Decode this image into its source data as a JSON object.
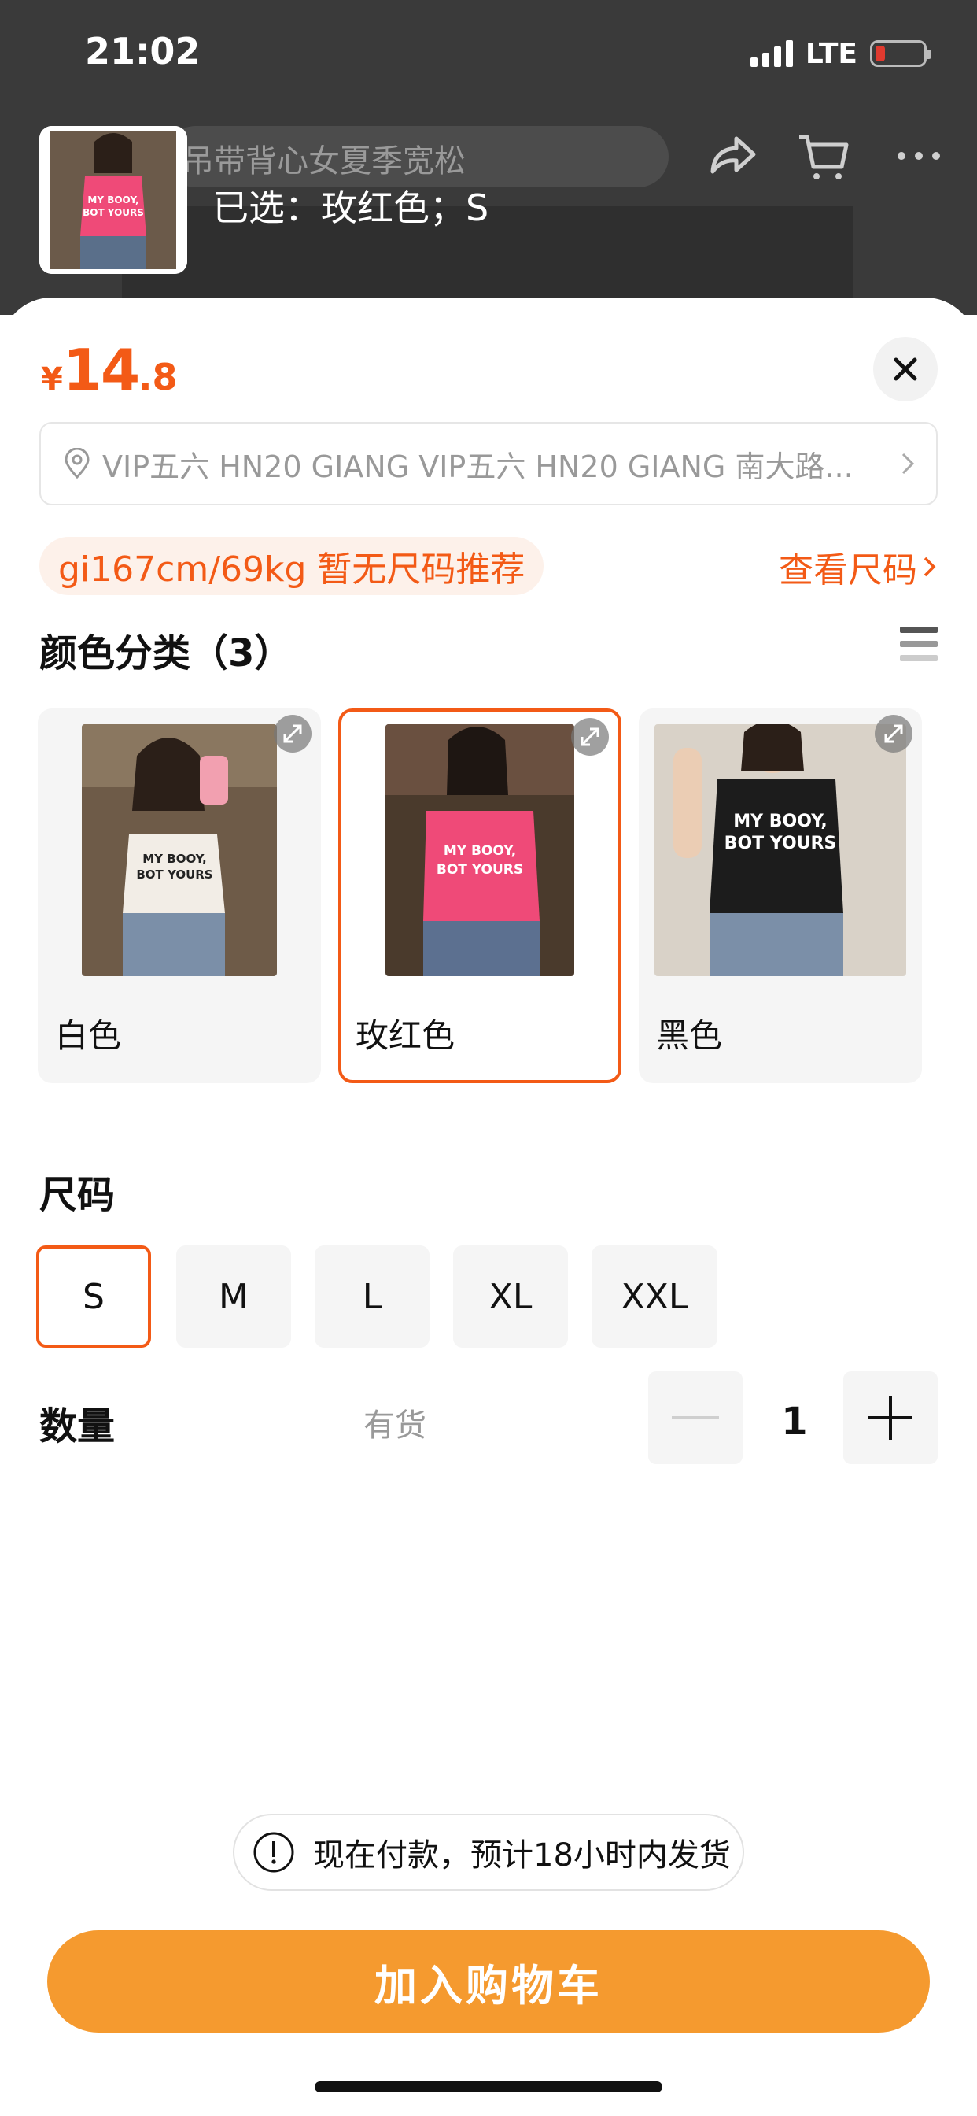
{
  "status_bar": {
    "time": "21:02",
    "network": "LTE",
    "battery_level": 0.2
  },
  "header": {
    "search_text": "吊带背心女夏季宽松",
    "selected_text": "已选：玫红色；S",
    "icons": [
      "share-icon",
      "cart-icon",
      "more-icon"
    ]
  },
  "price": {
    "currency": "¥",
    "integer": "14",
    "decimal": ".8"
  },
  "address": {
    "text": "VIP五六 HN20 GIANG VIP五六 HN20 GIANG 南大路..."
  },
  "size_recommend": {
    "pill": "gi167cm/69kg 暂无尺码推荐",
    "link": "查看尺码"
  },
  "color_section": {
    "title": "颜色分类（3）",
    "options": [
      {
        "label": "白色",
        "shirt_color": "#f2ede6",
        "print_color": "#222222",
        "selected": false
      },
      {
        "label": "玫红色",
        "shirt_color": "#ef4a78",
        "print_color": "#ffffff",
        "selected": true
      },
      {
        "label": "黑色",
        "shirt_color": "#1c1c1c",
        "print_color": "#ffffff",
        "selected": false
      }
    ]
  },
  "size_section": {
    "title": "尺码",
    "options": [
      {
        "label": "S",
        "selected": true
      },
      {
        "label": "M",
        "selected": false
      },
      {
        "label": "L",
        "selected": false
      },
      {
        "label": "XL",
        "selected": false
      },
      {
        "label": "XXL",
        "selected": false
      }
    ]
  },
  "quantity": {
    "label": "数量",
    "stock": "有货",
    "value": "1"
  },
  "notice": {
    "text": "现在付款，预计18小时内发货"
  },
  "cart_button": {
    "label": "加入购物车"
  },
  "colors": {
    "accent": "#f35a16",
    "cart": "#f59a2f"
  }
}
